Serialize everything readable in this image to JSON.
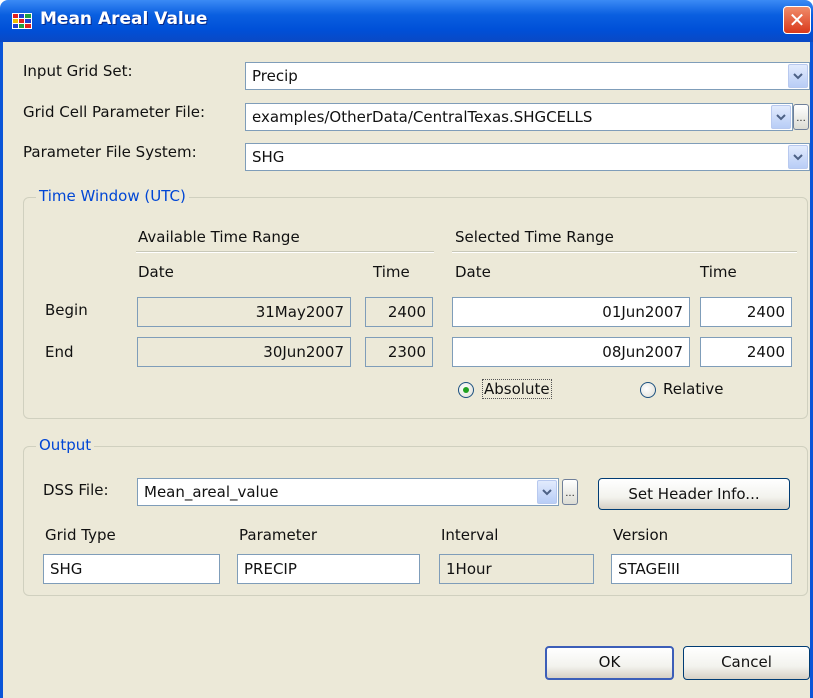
{
  "window": {
    "title": "Mean Areal Value",
    "app_icon": "grid-app-icon",
    "close_icon": "close-icon"
  },
  "inputs": {
    "grid_set_label": "Input Grid Set:",
    "grid_set_value": "Precip",
    "cell_file_label": "Grid Cell Parameter File:",
    "cell_file_value": "examples/OtherData/CentralTexas.SHGCELLS",
    "file_system_label": "Parameter File System:",
    "file_system_value": "SHG",
    "browse_label": "..."
  },
  "time_window": {
    "title": "Time Window (UTC)",
    "available_header": "Available Time Range",
    "selected_header": "Selected Time Range",
    "date_col": "Date",
    "time_col": "Time",
    "begin_label": "Begin",
    "end_label": "End",
    "available_begin_date": "31May2007",
    "available_begin_time": "2400",
    "available_end_date": "30Jun2007",
    "available_end_time": "2300",
    "selected_begin_date": "01Jun2007",
    "selected_begin_time": "2400",
    "selected_end_date": "08Jun2007",
    "selected_end_time": "2400",
    "absolute_label": "Absolute",
    "relative_label": "Relative",
    "mode_selected": "Absolute"
  },
  "output": {
    "title": "Output",
    "dss_label": "DSS File:",
    "dss_value": "Mean_areal_value",
    "browse_label": "...",
    "header_button": "Set Header Info...",
    "grid_type_label": "Grid Type",
    "grid_type_value": "SHG",
    "parameter_label": "Parameter",
    "parameter_value": "PRECIP",
    "interval_label": "Interval",
    "interval_value": "1Hour",
    "version_label": "Version",
    "version_value": "STAGEIII"
  },
  "buttons": {
    "ok": "OK",
    "cancel": "Cancel"
  },
  "colors": {
    "titlebar": "#0a5fe0",
    "dialog_bg": "#ece9d8",
    "group_title": "#0046d5",
    "close_button": "#d9381a"
  }
}
